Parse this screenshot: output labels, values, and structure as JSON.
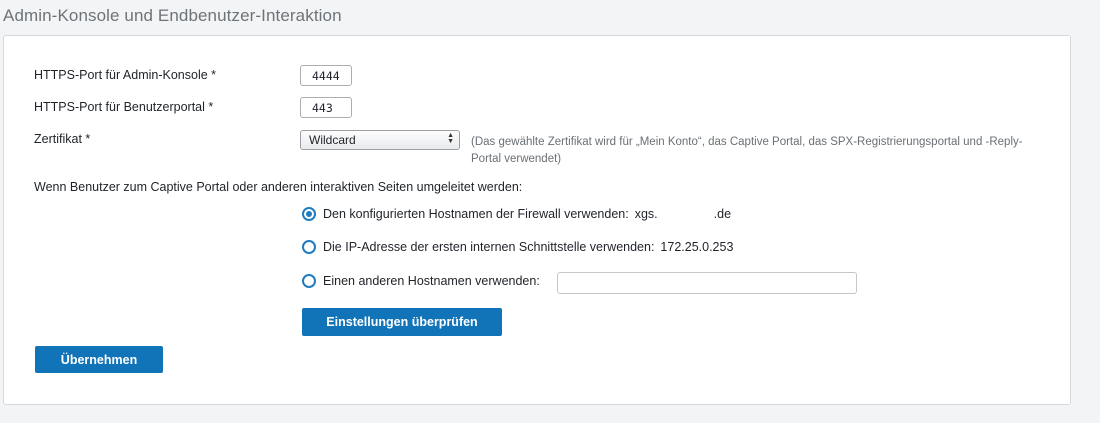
{
  "page": {
    "title": "Admin-Konsole und Endbenutzer-Interaktion"
  },
  "form": {
    "admin_port_label": "HTTPS-Port für Admin-Konsole *",
    "admin_port_value": "4444",
    "user_port_label": "HTTPS-Port für Benutzerportal *",
    "user_port_value": "443",
    "cert_label": "Zertifikat *",
    "cert_selected": "Wildcard",
    "cert_hint": "(Das gewählte Zertifikat wird für „Mein Konto“, das Captive Portal, das SPX-Registrierungsportal und -Reply-Portal verwendet)",
    "redirect_intro": "Wenn Benutzer zum Captive Portal oder anderen interaktiven Seiten umgeleitet werden:",
    "options": [
      {
        "label": "Den konfigurierten Hostnamen der Firewall verwenden:",
        "value_prefix": "xgs.",
        "value_suffix": ".de",
        "checked": true
      },
      {
        "label": "Die IP-Adresse der ersten internen Schnittstelle verwenden:",
        "value": "172.25.0.253",
        "checked": false
      },
      {
        "label": "Einen anderen Hostnamen verwenden:",
        "input_value": "",
        "checked": false
      }
    ],
    "check_button": "Einstellungen überprüfen",
    "apply_button": "Übernehmen"
  },
  "colors": {
    "accent": "#1174b9",
    "radio": "#1f7cc0",
    "title": "#6d7479"
  }
}
